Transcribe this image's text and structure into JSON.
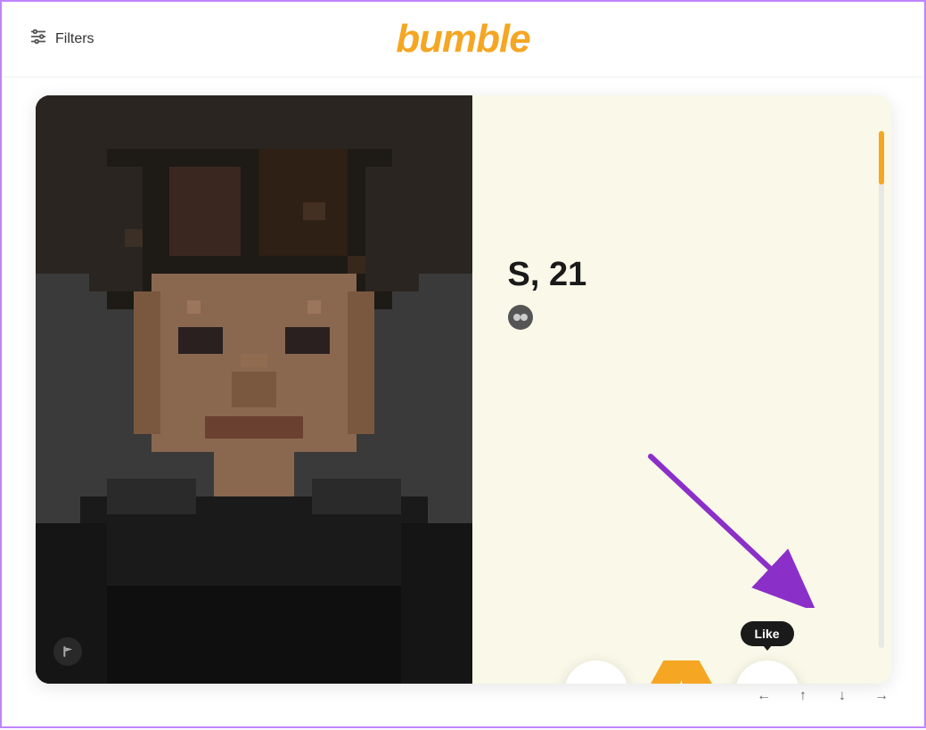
{
  "header": {
    "filters_label": "Filters",
    "app_title": "bumble"
  },
  "profile": {
    "name_age": "S, 21",
    "badge": "••"
  },
  "actions": {
    "dislike_label": "✕",
    "superlike_label": "★",
    "like_label": "✓",
    "like_tooltip": "Like"
  },
  "nav": {
    "left": "←",
    "up": "↑",
    "down": "↓",
    "right": "→"
  },
  "colors": {
    "accent": "#f5a623",
    "purple_border": "#c084fc",
    "card_bg": "#faf8e8"
  }
}
